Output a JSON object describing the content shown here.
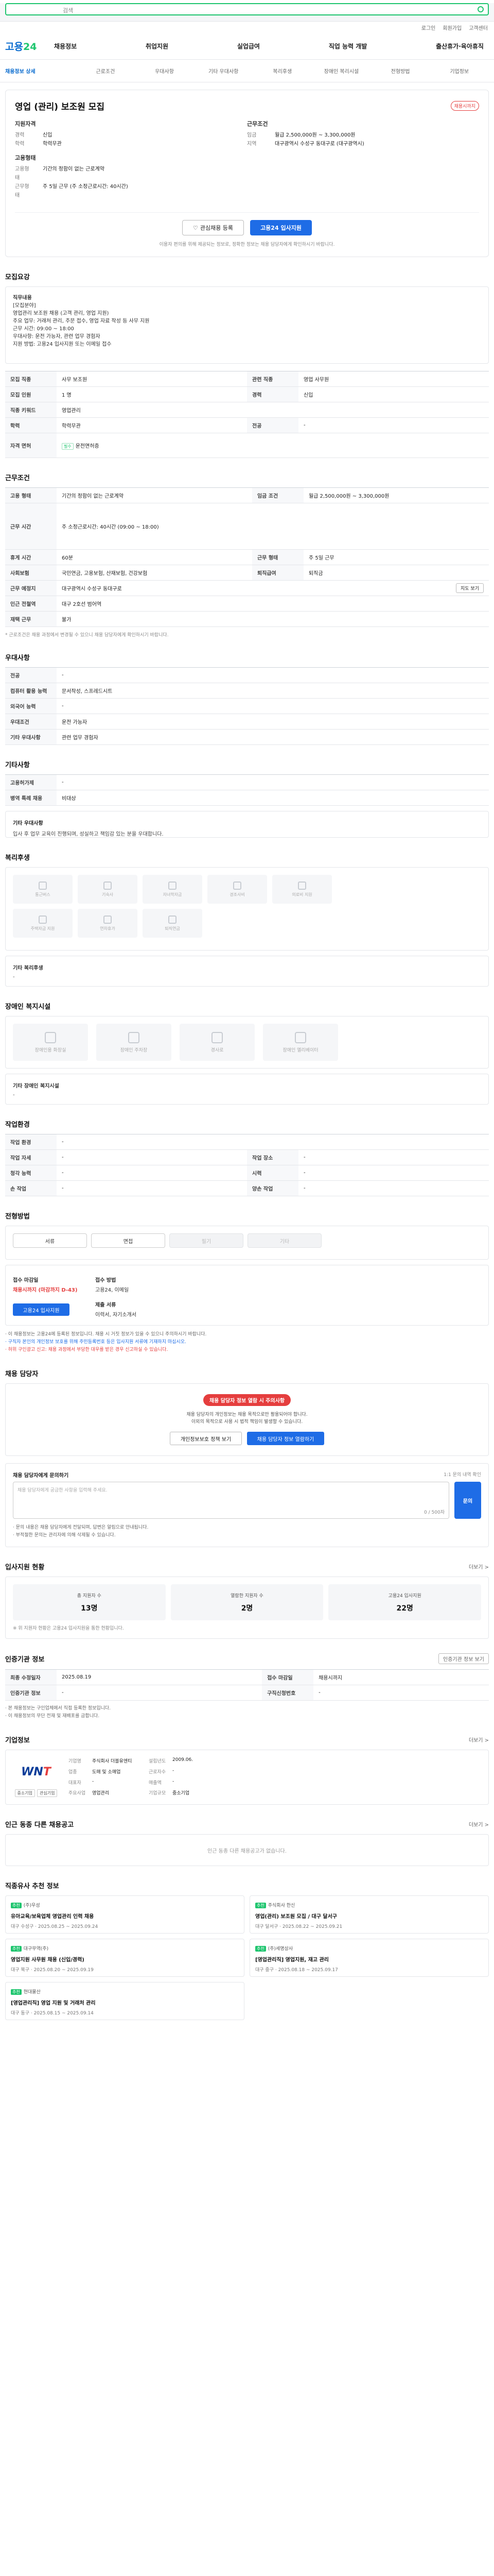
{
  "header": {
    "search_placeholder": "검색",
    "util": [
      "로그인",
      "회원가입",
      "고객센터"
    ],
    "logo_a": "고용",
    "logo_b": "24",
    "menu": [
      "채용정보",
      "취업지원",
      "실업급여",
      "직업 능력 개발",
      "출산휴가·육아휴직"
    ],
    "subnav": [
      "채용정보 상세",
      "근로조건",
      "우대사항",
      "기타 우대사항",
      "복리후생",
      "장애인 복리시설",
      "전형방법",
      "기업정보"
    ]
  },
  "job": {
    "title": "영업 (관리) 보조원 모집",
    "badge": "채용시까지",
    "left_group_title": "지원자격",
    "left_rows": [
      {
        "k": "경력",
        "v": "신입"
      },
      {
        "k": "학력",
        "v": "학력무관"
      }
    ],
    "left_group2_title": "고용형태",
    "left_rows2": [
      {
        "k": "고용형태",
        "v": "기간의 정함이 없는 근로계약"
      },
      {
        "k": "근무형태",
        "v": "주 5일 근무 (주 소정근로시간: 40시간)"
      }
    ],
    "right_group_title": "근무조건",
    "right_rows": [
      {
        "k": "임금",
        "v": "월급 2,500,000원 ~ 3,300,000원"
      },
      {
        "k": "지역",
        "v": "대구광역시 수성구 동대구로 (대구광역시)"
      }
    ],
    "interest_btn": "관심채용 등록",
    "apply_btn": "고용24 입사지원",
    "notice": "이용자 편의를 위해 제공되는 정보로, 정확한 정보는 채용 담당자에게 확인하시기 바랍니다."
  },
  "desc": {
    "title": "모집요강",
    "lines": [
      {
        "t": "직무내용",
        "b": true
      },
      {
        "t": "[모집분야]",
        "b": false
      },
      {
        "t": "영업관리 보조원 채용 (고객 관리, 영업 지원)",
        "b": false
      },
      {
        "t": "주요 업무: 거래처 관리, 주문 접수, 영업 자료 작성 등 사무 지원",
        "b": false
      },
      {
        "t": "근무 시간: 09:00 ~ 18:00",
        "b": false
      },
      {
        "t": "우대사항: 운전 가능자, 관련 업무 경험자",
        "b": false
      },
      {
        "t": "지원 방법: 고용24 입사지원 또는 이메일 접수",
        "b": false
      }
    ],
    "table": [
      {
        "k1": "모집 직종",
        "v1": "사무 보조원",
        "k2": "관련 직종",
        "v2": "영업 사무원"
      },
      {
        "k1": "모집 인원",
        "v1": "1 명",
        "k2": "경력",
        "v2": "신입"
      },
      {
        "k1": "직종 키워드",
        "v1": "영업관리",
        "k2": "",
        "v2": ""
      },
      {
        "k1": "학력",
        "v1": "학력무관",
        "k2": "전공",
        "v2": "-"
      },
      {
        "k1": "자격 면허",
        "v1": "운전면허증",
        "k2": "",
        "v2": ""
      }
    ]
  },
  "cond": {
    "title": "근무조건",
    "table": [
      {
        "k1": "고용 형태",
        "v1": "기간의 정함이 없는 근로계약",
        "k2": "임금 조건",
        "v2": "월급 2,500,000원 ~ 3,300,000원"
      },
      {
        "k1": "근무 시간",
        "v1": "주 소정근로시간: 40시간 (09:00 ~ 18:00)",
        "k2": "",
        "v2": ""
      },
      {
        "k1": "휴게 시간",
        "v1": "60분",
        "k2": "근무 형태",
        "v2": "주 5일 근무"
      },
      {
        "k1": "사회보험",
        "v1": "국민연금, 고용보험, 산재보험, 건강보험",
        "k2": "퇴직급여",
        "v2": "퇴직금"
      },
      {
        "k1": "근무 예정지",
        "v1": "대구광역시 수성구 동대구로",
        "k2": "",
        "v2": ""
      },
      {
        "k1": "인근 전철역",
        "v1": "대구 2호선 범어역",
        "k2": "",
        "v2": ""
      },
      {
        "k1": "재택 근무",
        "v1": "불가",
        "k2": "",
        "v2": ""
      }
    ],
    "note": "* 근로조건은 채용 과정에서 변경될 수 있으니 채용 담당자에게 확인하시기 바랍니다.",
    "map_btn": "지도 보기"
  },
  "pref": {
    "title": "우대사항",
    "rows": [
      {
        "k": "전공",
        "v": "-"
      },
      {
        "k": "컴퓨터 활용 능력",
        "v": "문서작성, 스프레드시트"
      },
      {
        "k": "외국어 능력",
        "v": "-"
      },
      {
        "k": "우대조건",
        "v": "운전 가능자"
      },
      {
        "k": "기타 우대사항",
        "v": "관련 업무 경험자"
      }
    ]
  },
  "etc": {
    "title": "기타사항",
    "rows": [
      {
        "k": "고용허가제",
        "v": "-"
      },
      {
        "k": "병역 특례 채용",
        "v": "비대상"
      }
    ],
    "note_title": "기타 우대사항",
    "note": "입사 후 업무 교육이 진행되며, 성실하고 책임감 있는 분을 우대합니다."
  },
  "welfare": {
    "title": "복리후생",
    "tiles": [
      "통근버스",
      "기숙사",
      "자녀학자금",
      "경조사비",
      "의료비 지원",
      "주택자금 지원",
      "연차휴가",
      "퇴직연금"
    ],
    "other_k": "기타 복리후생",
    "other_v": "-"
  },
  "facility": {
    "title": "장애인 복지시설",
    "tiles": [
      "장애인용 화장실",
      "장애인 주차장",
      "경사로",
      "장애인 엘리베이터"
    ],
    "other_k": "기타 장애인 복지시설",
    "other_v": "-"
  },
  "env": {
    "title": "작업환경",
    "table": [
      {
        "k1": "작업 환경",
        "v1": "-",
        "k2": "",
        "v2": ""
      },
      {
        "k1": "작업 자세",
        "v1": "-",
        "k2": "작업 장소",
        "v2": "-"
      },
      {
        "k1": "청각 능력",
        "v1": "-",
        "k2": "시력",
        "v2": "-"
      },
      {
        "k1": "손 작업",
        "v1": "-",
        "k2": "양손 작업",
        "v2": "-"
      }
    ]
  },
  "apply": {
    "title": "전형방법",
    "methods": [
      {
        "l": "서류",
        "d": false
      },
      {
        "l": "면접",
        "d": false
      },
      {
        "l": "필기",
        "d": true
      },
      {
        "l": "기타",
        "d": true
      }
    ],
    "deadline_t": "접수 마감일",
    "deadline_v": "채용시까지 (마감까지 D-43)",
    "way_t": "접수 방법",
    "way_v": "고용24, 이메일",
    "doc_t": "제출 서류",
    "doc_v": "이력서, 자기소개서",
    "btn": "고용24 입사지원",
    "bullets": [
      {
        "t": "· 이 채용정보는 고용24에 등록된 정보입니다. 채용 시 거짓 정보가 있을 수 있으니 주의하시기 바랍니다.",
        "c": ""
      },
      {
        "t": "· 구직자 본인의 개인정보 보호를 위해 주민등록번호 등은 입사지원 서류에 기재하지 마십시오.",
        "c": "bl"
      },
      {
        "t": "· 허위 구인광고 신고: 채용 과정에서 부당한 대우를 받은 경우 신고하실 수 있습니다.",
        "c": "rd"
      }
    ]
  },
  "manager": {
    "title": "채용 담당자",
    "pill": "채용 담당자 정보 열람 시 주의사항",
    "t1": "채용 담당자의 개인정보는 채용 목적으로만 활용되어야 합니다.",
    "t2": "이외의 목적으로 사용 시 법적 책임이 발생할 수 있습니다.",
    "btn_o": "개인정보보호 정책 보기",
    "btn_b": "채용 담당자 정보 열람하기"
  },
  "question": {
    "label": "채용 담당자에게 문의하기",
    "right": "1:1 문의 내역 확인",
    "placeholder": "채용 담당자에게 궁금한 사항을 입력해 주세요.",
    "counter": "0 / 500자",
    "btn": "문의",
    "bullets": [
      "· 문의 내용은 채용 담당자에게 전달되며, 답변은 알림으로 안내됩니다.",
      "· 부적절한 문의는 관리자에 의해 삭제될 수 있습니다."
    ]
  },
  "status": {
    "title": "입사지원 현황",
    "more": "더보기 >",
    "stats": [
      {
        "l": "총 지원자 수",
        "n": "13명"
      },
      {
        "l": "열람한 지원자 수",
        "n": "2명"
      },
      {
        "l": "고용24 입사지원",
        "n": "22명"
      }
    ],
    "note": "※ 위 지원자 현황은 고용24 입사지원을 통한 현황입니다."
  },
  "org": {
    "title": "인증기관 정보",
    "btn": "인증기관 정보 보기",
    "table": [
      {
        "k1": "최종 수정일자",
        "v1": "2025.08.19",
        "k2": "접수 마감일",
        "v2": "채용시까지"
      },
      {
        "k1": "인증기관 정보",
        "v1": "-",
        "k2": "구직신청번호",
        "v2": "-"
      }
    ],
    "bullets": [
      "· 본 채용정보는 구인업체에서 직접 등록한 정보입니다.",
      "· 이 채용정보의 무단 전재 및 재배포를 금합니다."
    ]
  },
  "company": {
    "title": "기업정보",
    "more": "더보기 >",
    "logo_a": "WN",
    "logo_b": "T",
    "tags": [
      "중소기업",
      "관심기업"
    ],
    "grid": [
      {
        "k": "기업명",
        "v": "주식회사 더블유엔티"
      },
      {
        "k": "설립년도",
        "v": "2009.06."
      },
      {
        "k": "업종",
        "v": "도매 및 소매업"
      },
      {
        "k": "근로자수",
        "v": "-"
      },
      {
        "k": "대표자",
        "v": "-"
      },
      {
        "k": "매출액",
        "v": "-"
      },
      {
        "k": "주요사업",
        "v": "영업관리"
      },
      {
        "k": "기업규모",
        "v": "중소기업"
      }
    ]
  },
  "other": {
    "title": "인근 동종 다른 채용공고",
    "more": "더보기 >",
    "empty": "인근 동종 다른 채용공고가 없습니다."
  },
  "recommend": {
    "title": "직종유사 추천 정보",
    "items": [
      {
        "tag": "추천",
        "co": "(주)우성",
        "title": "유아교육/보육업체 영업관리 인력 채용",
        "meta": "대구 수성구 · 2025.08.25 ~ 2025.09.24"
      },
      {
        "tag": "추천",
        "co": "주식회사 한신",
        "title": "영업(관리) 보조원 모집 / 대구 달서구",
        "meta": "대구 달서구 · 2025.08.22 ~ 2025.09.21"
      },
      {
        "tag": "추천",
        "co": "대구무역(주)",
        "title": "영업지원 사무원 채용 (신입/경력)",
        "meta": "대구 북구 · 2025.08.20 ~ 2025.09.19"
      },
      {
        "tag": "추천",
        "co": "(주)세명상사",
        "title": "[영업관리직] 영업지원, 재고 관리",
        "meta": "대구 중구 · 2025.08.18 ~ 2025.09.17"
      },
      {
        "tag": "추천",
        "co": "현대물산",
        "title": "[영업관리직] 영업 지원 및 거래처 관리",
        "meta": "대구 동구 · 2025.08.15 ~ 2025.09.14"
      }
    ]
  }
}
